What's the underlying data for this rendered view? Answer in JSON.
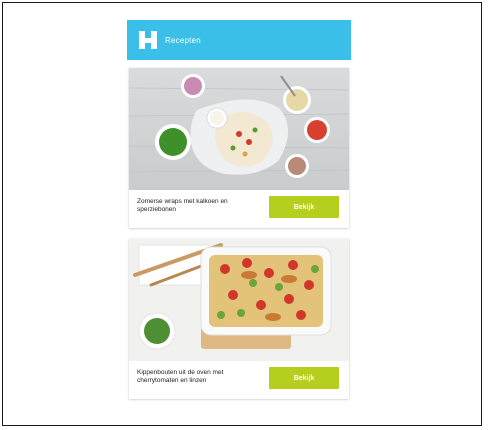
{
  "app": {
    "title": "Recepten",
    "logo_icon": "h-logo-icon",
    "accent_color": "#39bfe8",
    "button_color": "#b6cf1f"
  },
  "recipes": [
    {
      "caption": "Zomerse wraps met kalkoen en sperziebonen",
      "button_label": "Bekijk",
      "image_icon": "wraps-photo"
    },
    {
      "caption": "Kippenbouten uit de oven met cherrytomaten en linzen",
      "button_label": "Bekijk",
      "image_icon": "oven-dish-photo"
    }
  ]
}
